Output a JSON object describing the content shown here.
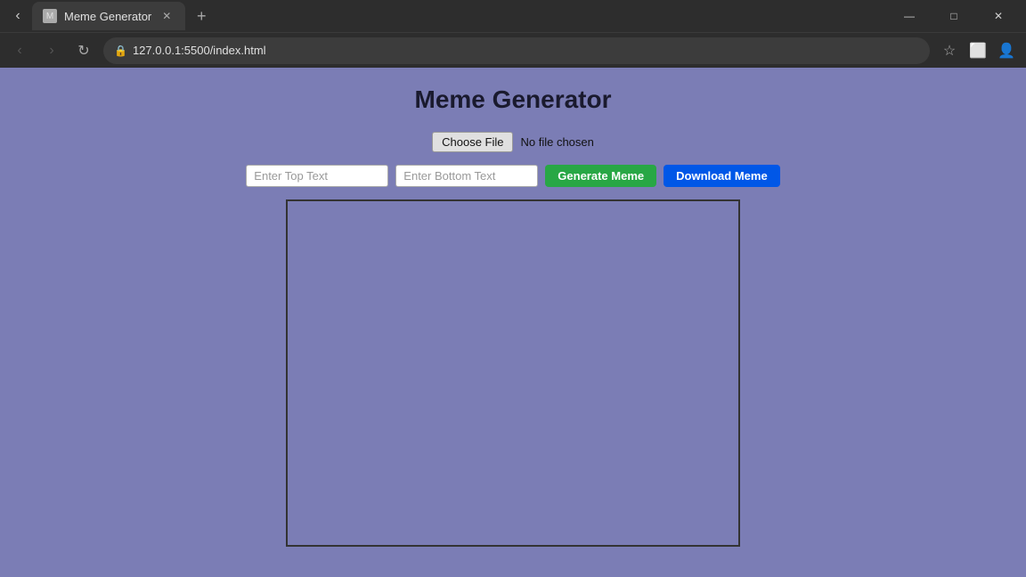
{
  "browser": {
    "tab": {
      "title": "Meme Generator",
      "favicon": "M"
    },
    "url": "127.0.0.1:5500/index.html",
    "window_controls": {
      "minimize": "—",
      "maximize": "□",
      "close": "✕"
    }
  },
  "toolbar": {
    "back": "‹",
    "forward": "›",
    "reload": "↻",
    "new_tab": "+",
    "bookmark": "☆",
    "extensions": "⬜",
    "profile": "👤"
  },
  "page": {
    "title": "Meme Generator",
    "file_input": {
      "button_label": "Choose File",
      "no_file_text": "No file chosen"
    },
    "top_text_placeholder": "Enter Top Text",
    "bottom_text_placeholder": "Enter Bottom Text",
    "generate_button": "Generate Meme",
    "download_button": "Download Meme"
  }
}
